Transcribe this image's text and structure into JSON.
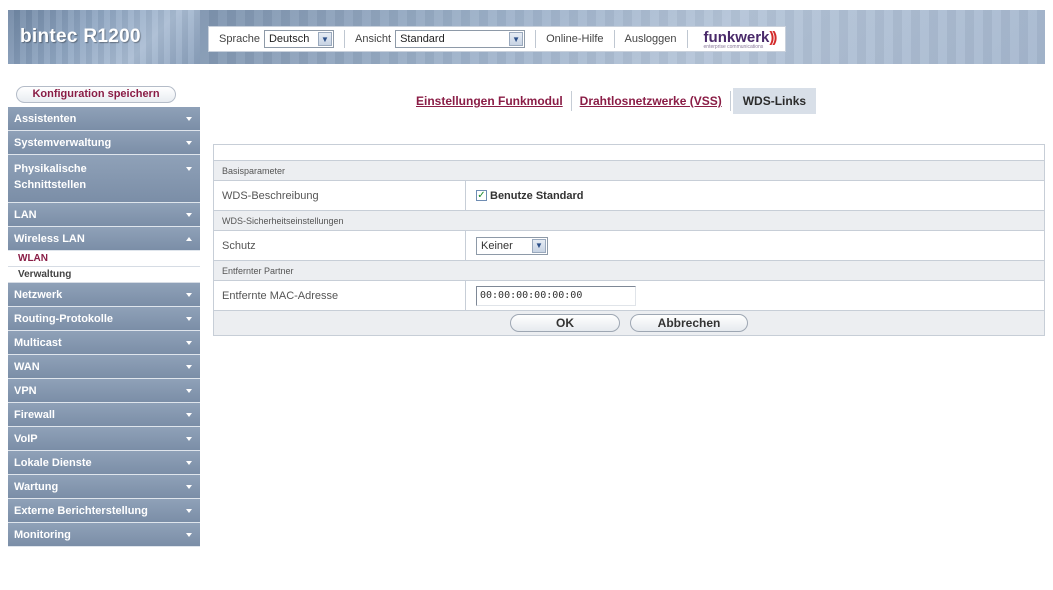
{
  "header": {
    "brand": "bintec R1200",
    "language_label": "Sprache",
    "language_value": "Deutsch",
    "view_label": "Ansicht",
    "view_value": "Standard",
    "help_link": "Online-Hilfe",
    "logout_link": "Ausloggen",
    "logo_text": "funkwerk",
    "logo_waves": "))",
    "logo_tagline": "enterprise communications"
  },
  "sidebar": {
    "save_button": "Konfiguration speichern",
    "items": [
      {
        "label": "Assistenten"
      },
      {
        "label": "Systemverwaltung"
      },
      {
        "label": "Physikalische Schnittstellen"
      },
      {
        "label": "LAN"
      },
      {
        "label": "Wireless LAN"
      },
      {
        "label": "Netzwerk"
      },
      {
        "label": "Routing-Protokolle"
      },
      {
        "label": "Multicast"
      },
      {
        "label": "WAN"
      },
      {
        "label": "VPN"
      },
      {
        "label": "Firewall"
      },
      {
        "label": "VoIP"
      },
      {
        "label": "Lokale Dienste"
      },
      {
        "label": "Wartung"
      },
      {
        "label": "Externe Berichterstellung"
      },
      {
        "label": "Monitoring"
      }
    ],
    "subitems": [
      {
        "label": "WLAN"
      },
      {
        "label": "Verwaltung"
      }
    ]
  },
  "tabs": [
    {
      "label": "Einstellungen Funkmodul"
    },
    {
      "label": "Drahtlosnetzwerke (VSS)"
    },
    {
      "label": "WDS-Links"
    }
  ],
  "form": {
    "sections": [
      {
        "title": "Basisparameter"
      },
      {
        "title": "WDS-Sicherheitseinstellungen"
      },
      {
        "title": "Entfernter Partner"
      }
    ],
    "description_label": "WDS-Beschreibung",
    "use_default_label": "Benutze Standard",
    "use_default_checked": "✓",
    "protection_label": "Schutz",
    "protection_value": "Keiner",
    "remote_mac_label": "Entfernte MAC-Adresse",
    "remote_mac_value": "00:00:00:00:00:00",
    "ok_button": "OK",
    "cancel_button": "Abbrechen"
  },
  "colors": {
    "accent": "#8a1d46",
    "sidebar": "#8496ae",
    "section_bg": "#eceef1"
  }
}
